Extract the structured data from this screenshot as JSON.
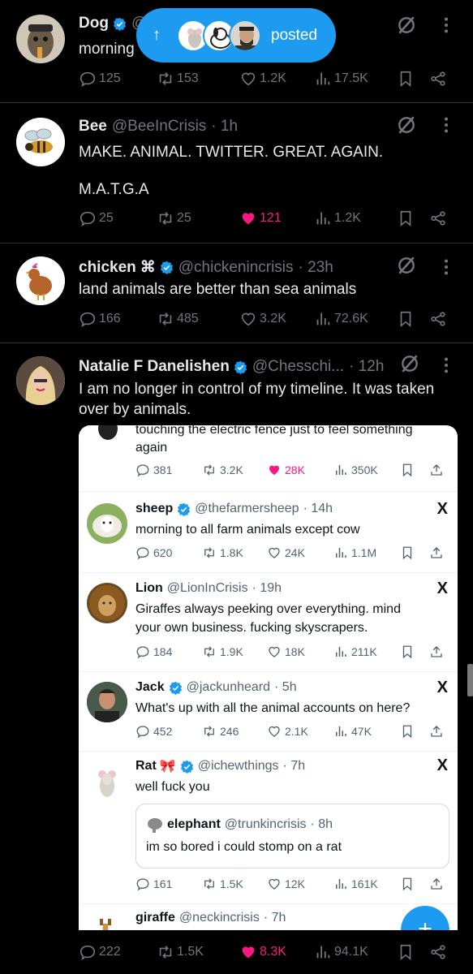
{
  "colors": {
    "accent": "#1d9bf0",
    "like": "#f91880",
    "muted": "#71767b",
    "background": "#000000"
  },
  "posted_pill": {
    "label": "posted",
    "arrow": "↑"
  },
  "posts": [
    {
      "name": "Dog",
      "handle": "@",
      "time": "",
      "text": "morning",
      "reply": "125",
      "retweet": "153",
      "like": "1.2K",
      "views": "17.5K",
      "liked": false
    },
    {
      "name": "Bee",
      "handle": "@BeeInCrisis",
      "time": "· 1h",
      "text": "MAKE. ANIMAL. TWITTER. GREAT. AGAIN.",
      "text2": "M.A.T.G.A",
      "reply": "25",
      "retweet": "25",
      "like": "121",
      "views": "1.2K",
      "liked": true
    },
    {
      "name": "chicken",
      "name_emoji": "⌘",
      "handle": "@chickenincrisis",
      "time": "· 23h",
      "text": "land animals are better than sea animals",
      "reply": "166",
      "retweet": "485",
      "like": "3.2K",
      "views": "72.6K",
      "liked": false
    },
    {
      "name": "Natalie F Danelishen",
      "handle": "@Chesschi...",
      "time": "· 12h",
      "text": "I am no longer in control of my timeline. It was taken over by animals.",
      "reply": "222",
      "retweet": "1.5K",
      "like": "8.3K",
      "views": "94.1K",
      "liked": true
    }
  ],
  "card": {
    "top_partial": {
      "text1": "touching the electric fence just to feel something",
      "text2": "again",
      "reply": "381",
      "retweet": "3.2K",
      "like": "28K",
      "views": "350K"
    },
    "tweets": [
      {
        "name": "sheep",
        "handle": "@thefarmersheep",
        "time": "· 14h",
        "text": "morning to all farm animals except cow",
        "reply": "620",
        "retweet": "1.8K",
        "like": "24K",
        "views": "1.1M"
      },
      {
        "name": "Lion",
        "handle": "@LionInCrisis",
        "time": "· 19h",
        "text": "Giraffes always peeking over everything. mind",
        "text2": "your own business. fucking skyscrapers.",
        "reply": "184",
        "retweet": "1.9K",
        "like": "18K",
        "views": "211K"
      },
      {
        "name": "Jack",
        "handle": "@jackunheard",
        "time": "· 5h",
        "text": "What's up with all the animal accounts on here?",
        "reply": "452",
        "retweet": "246",
        "like": "2.1K",
        "views": "47K"
      },
      {
        "name": "Rat",
        "name_emoji": "🎀",
        "handle": "@ichewthings",
        "time": "· 7h",
        "text": "well fuck you",
        "reply": "161",
        "retweet": "1.5K",
        "like": "12K",
        "views": "161K",
        "quote": {
          "name": "elephant",
          "handle": "@trunkincrisis",
          "time": "· 8h",
          "text": "im so bored i could stomp on a rat"
        }
      },
      {
        "name": "giraffe",
        "handle": "@neckincrisis",
        "time": "· 7h"
      }
    ],
    "x_logo": "X"
  },
  "fab_label": "+"
}
